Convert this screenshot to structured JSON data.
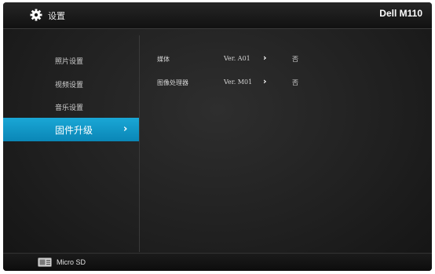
{
  "header": {
    "title": "设置",
    "brand": "Dell M110",
    "icon": "gear-icon"
  },
  "menu": {
    "items": [
      {
        "label": "照片设置"
      },
      {
        "label": "视频设置"
      },
      {
        "label": "音乐设置"
      },
      {
        "label": "固件升级",
        "active": true
      }
    ]
  },
  "firmware": {
    "rows": [
      {
        "name": "媒体",
        "version": "Ver. A01",
        "value": "否"
      },
      {
        "name": "图像处理器",
        "version": "Ver. M01",
        "value": "否"
      }
    ]
  },
  "footer": {
    "source_label": "Micro SD",
    "icon": "sd-card-icon"
  },
  "colors": {
    "accent": "#0f98c8",
    "background": "#222222"
  }
}
